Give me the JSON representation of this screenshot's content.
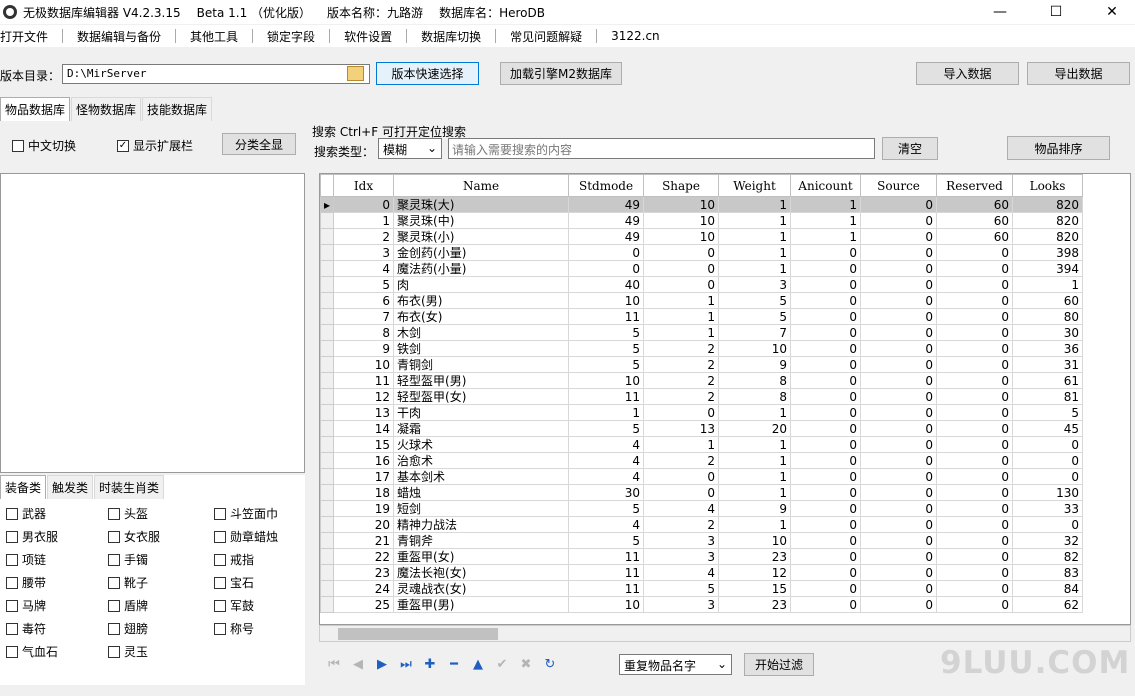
{
  "title": {
    "app": "无极数据库编辑器 V4.2.3.15",
    "beta": "Beta 1.1 （优化版）",
    "version_name": "版本名称：九路游",
    "db_name": "数据库名：HeroDB"
  },
  "window_controls": {
    "minimize": "—",
    "maximize": "☐",
    "close": "✕"
  },
  "menu": [
    "打开文件",
    "数据编辑与备份",
    "其他工具",
    "锁定字段",
    "软件设置",
    "数据库切换",
    "常见问题解疑",
    "3122.cn"
  ],
  "toolbar": {
    "dir_label": "版本目录：",
    "dir_value": "D:\\MirServer",
    "quick_select": "版本快速选择",
    "load_m2": "加载引擎M2数据库",
    "import": "导入数据",
    "export": "导出数据"
  },
  "main_tabs": [
    "物品数据库",
    "怪物数据库",
    "技能数据库"
  ],
  "options": {
    "cn_switch": "中文切换",
    "show_ext": "显示扩展栏",
    "show_all": "分类全显"
  },
  "search": {
    "title": "搜索   Ctrl+F 可打开定位搜索",
    "type_label": "搜索类型：",
    "type_value": "模糊",
    "placeholder": "请输入需要搜索的内容",
    "clear": "清空",
    "sort": "物品排序"
  },
  "category_tabs": [
    "装备类",
    "触发类",
    "时装生肖类"
  ],
  "categories": [
    "武器",
    "头盔",
    "斗笠面巾",
    "男衣服",
    "女衣服",
    "勋章蜡烛",
    "项链",
    "手镯",
    "戒指",
    "腰带",
    "靴子",
    "宝石",
    "马牌",
    "盾牌",
    "军鼓",
    "毒符",
    "翅膀",
    "称号",
    "气血石",
    "灵玉"
  ],
  "table": {
    "columns": [
      "Idx",
      "Name",
      "Stdmode",
      "Shape",
      "Weight",
      "Anicount",
      "Source",
      "Reserved",
      "Looks"
    ],
    "rows": [
      [
        "0",
        "聚灵珠(大)",
        "49",
        "10",
        "1",
        "1",
        "0",
        "60",
        "820"
      ],
      [
        "1",
        "聚灵珠(中)",
        "49",
        "10",
        "1",
        "1",
        "0",
        "60",
        "820"
      ],
      [
        "2",
        "聚灵珠(小)",
        "49",
        "10",
        "1",
        "1",
        "0",
        "60",
        "820"
      ],
      [
        "3",
        "金创药(小量)",
        "0",
        "0",
        "1",
        "0",
        "0",
        "0",
        "398"
      ],
      [
        "4",
        "魔法药(小量)",
        "0",
        "0",
        "1",
        "0",
        "0",
        "0",
        "394"
      ],
      [
        "5",
        "肉",
        "40",
        "0",
        "3",
        "0",
        "0",
        "0",
        "1"
      ],
      [
        "6",
        "布衣(男)",
        "10",
        "1",
        "5",
        "0",
        "0",
        "0",
        "60"
      ],
      [
        "7",
        "布衣(女)",
        "11",
        "1",
        "5",
        "0",
        "0",
        "0",
        "80"
      ],
      [
        "8",
        "木剑",
        "5",
        "1",
        "7",
        "0",
        "0",
        "0",
        "30"
      ],
      [
        "9",
        "铁剑",
        "5",
        "2",
        "10",
        "0",
        "0",
        "0",
        "36"
      ],
      [
        "10",
        "青铜剑",
        "5",
        "2",
        "9",
        "0",
        "0",
        "0",
        "31"
      ],
      [
        "11",
        "轻型盔甲(男)",
        "10",
        "2",
        "8",
        "0",
        "0",
        "0",
        "61"
      ],
      [
        "12",
        "轻型盔甲(女)",
        "11",
        "2",
        "8",
        "0",
        "0",
        "0",
        "81"
      ],
      [
        "13",
        "干肉",
        "1",
        "0",
        "1",
        "0",
        "0",
        "0",
        "5"
      ],
      [
        "14",
        "凝霜",
        "5",
        "13",
        "20",
        "0",
        "0",
        "0",
        "45"
      ],
      [
        "15",
        "火球术",
        "4",
        "1",
        "1",
        "0",
        "0",
        "0",
        "0"
      ],
      [
        "16",
        "治愈术",
        "4",
        "2",
        "1",
        "0",
        "0",
        "0",
        "0"
      ],
      [
        "17",
        "基本剑术",
        "4",
        "0",
        "1",
        "0",
        "0",
        "0",
        "0"
      ],
      [
        "18",
        "蜡烛",
        "30",
        "0",
        "1",
        "0",
        "0",
        "0",
        "130"
      ],
      [
        "19",
        "短剑",
        "5",
        "4",
        "9",
        "0",
        "0",
        "0",
        "33"
      ],
      [
        "20",
        "精神力战法",
        "4",
        "2",
        "1",
        "0",
        "0",
        "0",
        "0"
      ],
      [
        "21",
        "青铜斧",
        "5",
        "3",
        "10",
        "0",
        "0",
        "0",
        "32"
      ],
      [
        "22",
        "重盔甲(女)",
        "11",
        "3",
        "23",
        "0",
        "0",
        "0",
        "82"
      ],
      [
        "23",
        "魔法长袍(女)",
        "11",
        "4",
        "12",
        "0",
        "0",
        "0",
        "83"
      ],
      [
        "24",
        "灵魂战衣(女)",
        "11",
        "5",
        "15",
        "0",
        "0",
        "0",
        "84"
      ],
      [
        "25",
        "重盔甲(男)",
        "10",
        "3",
        "23",
        "0",
        "0",
        "0",
        "62"
      ]
    ]
  },
  "filter": {
    "dup_select": "重复物品名字",
    "start": "开始过滤"
  },
  "watermark": "9LUU.COM"
}
